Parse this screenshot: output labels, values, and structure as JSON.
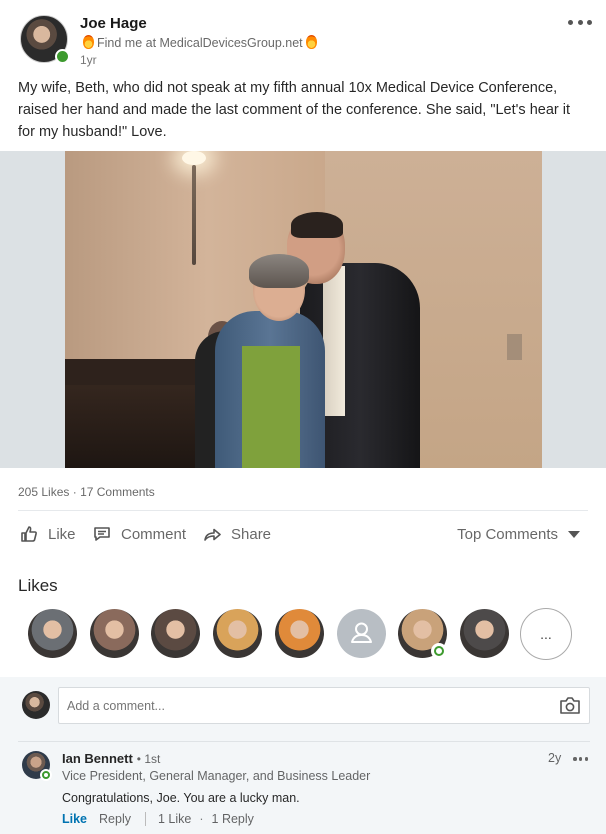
{
  "post": {
    "author_name": "Joe Hage",
    "headline": "Find me at MedicalDevicesGroup.net",
    "timestamp": "1yr",
    "text": "My wife,  Beth, who did not speak at my fifth annual 10x Medical Device Conference,  raised her hand and made the last comment of the conference. She said, \"Let's hear it for my husband!\" Love."
  },
  "social_counts": {
    "likes": "205 Likes",
    "separator": "·",
    "comments": "17 Comments"
  },
  "actions": {
    "like": "Like",
    "comment": "Comment",
    "share": "Share",
    "sort": "Top Comments"
  },
  "likes_section": {
    "title": "Likes",
    "more_label": "...",
    "avatar_colors": [
      "#6b6f74",
      "#8a6a5c",
      "#5b4a42",
      "#d9a35a",
      "#e08a3a",
      "#b8bec4",
      "#c9a27a",
      "#4d4a4a"
    ]
  },
  "comment_composer": {
    "placeholder": "Add a comment..."
  },
  "comment": {
    "author": "Ian Bennett",
    "degree": "• 1st",
    "headline": "Vice President, General Manager, and Business Leader",
    "body": "Congratulations, Joe. You are a lucky man.",
    "time": "2y",
    "like_label": "Like",
    "reply_label": "Reply",
    "like_count": "1 Like",
    "separator": "·",
    "reply_count": "1 Reply"
  },
  "colors": {
    "online_green": "#3d9a2e",
    "link_blue": "#0073b1",
    "comments_bg": "#f3f6f8"
  },
  "icons": [
    "more-icon",
    "fire-icon",
    "like-icon",
    "comment-icon",
    "share-icon",
    "caret-down-icon",
    "camera-icon",
    "person-placeholder-icon"
  ]
}
